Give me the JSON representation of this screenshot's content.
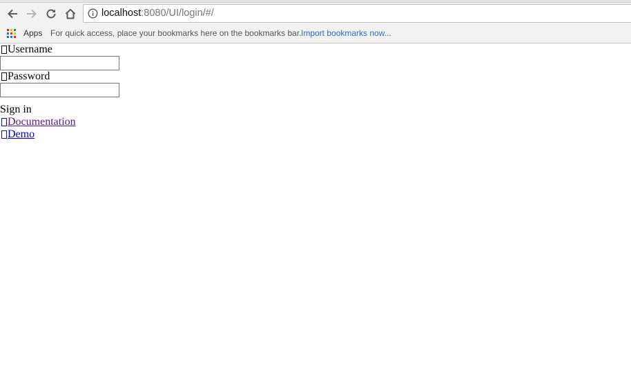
{
  "browser": {
    "url_host": "localhost",
    "url_rest": ":8080/UI/login/#/",
    "bookmarks_bar": {
      "apps_label": "Apps",
      "hint": "For quick access, place your bookmarks here on the bookmarks bar.",
      "import_link": "Import bookmarks now..."
    },
    "nav_icons": [
      "back-arrow-icon",
      "forward-arrow-icon",
      "reload-icon",
      "home-icon",
      "info-icon"
    ]
  },
  "login_form": {
    "username_label": "Username",
    "username_value": "",
    "password_label": "Password",
    "password_value": "",
    "sign_in_label": "Sign in"
  },
  "links": {
    "documentation_label": "Documentation",
    "demo_label": "Demo"
  },
  "colors": {
    "visited_link": "#551a8b",
    "link": "#0000ee",
    "bookmark_link": "#3367d6",
    "chrome_bg": "#f2f2f2"
  }
}
